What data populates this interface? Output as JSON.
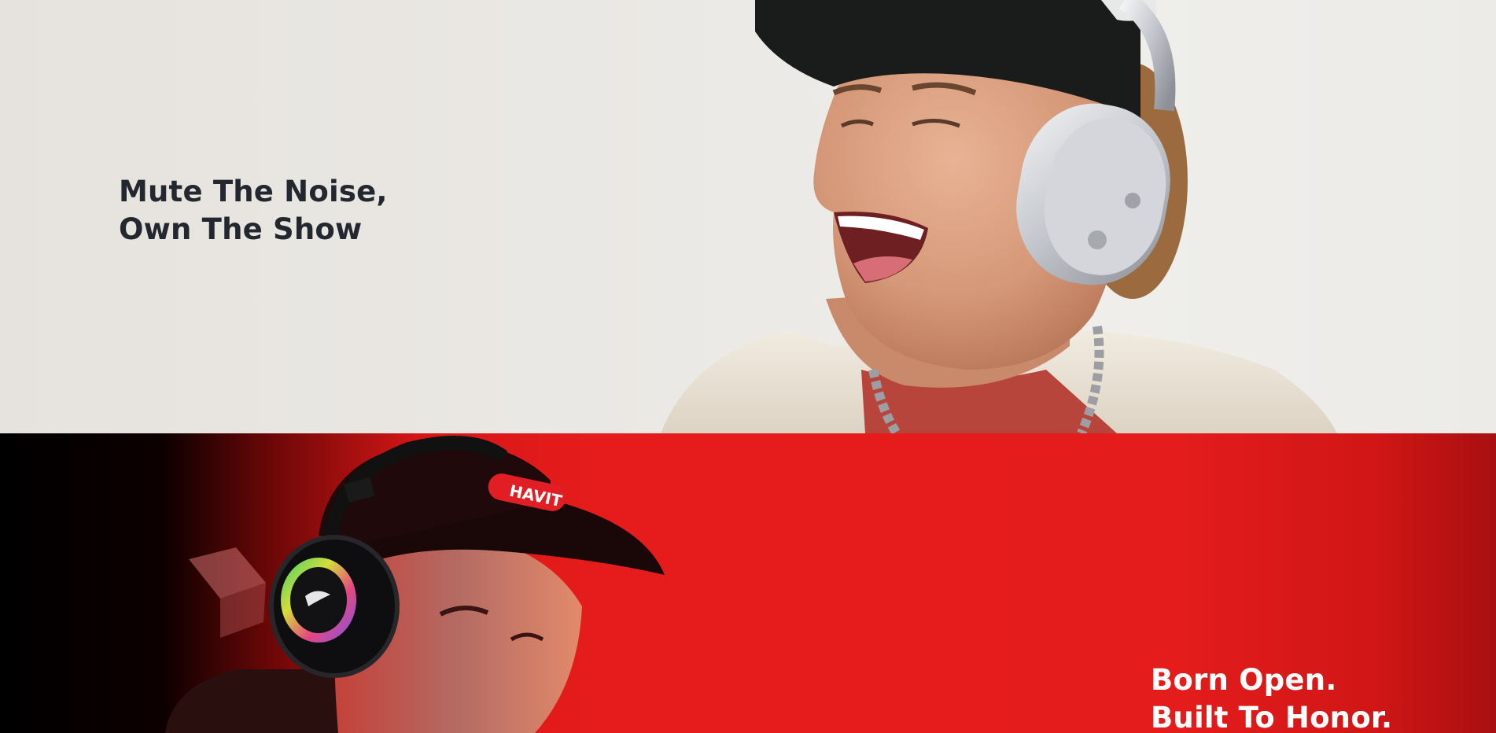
{
  "banner_top": {
    "headline_line1": "Mute The Noise,",
    "headline_line2": "Own The Show",
    "colors": {
      "background": "#e9e7e3",
      "text": "#23272f"
    }
  },
  "banner_bottom": {
    "headline_line1": "Born Open.",
    "headline_line2": "Built To Honor.",
    "cap_logo_text": "HAVIT",
    "colors": {
      "background": "#e51c1c",
      "text": "#ffffff",
      "left_fade": "#000000"
    }
  }
}
